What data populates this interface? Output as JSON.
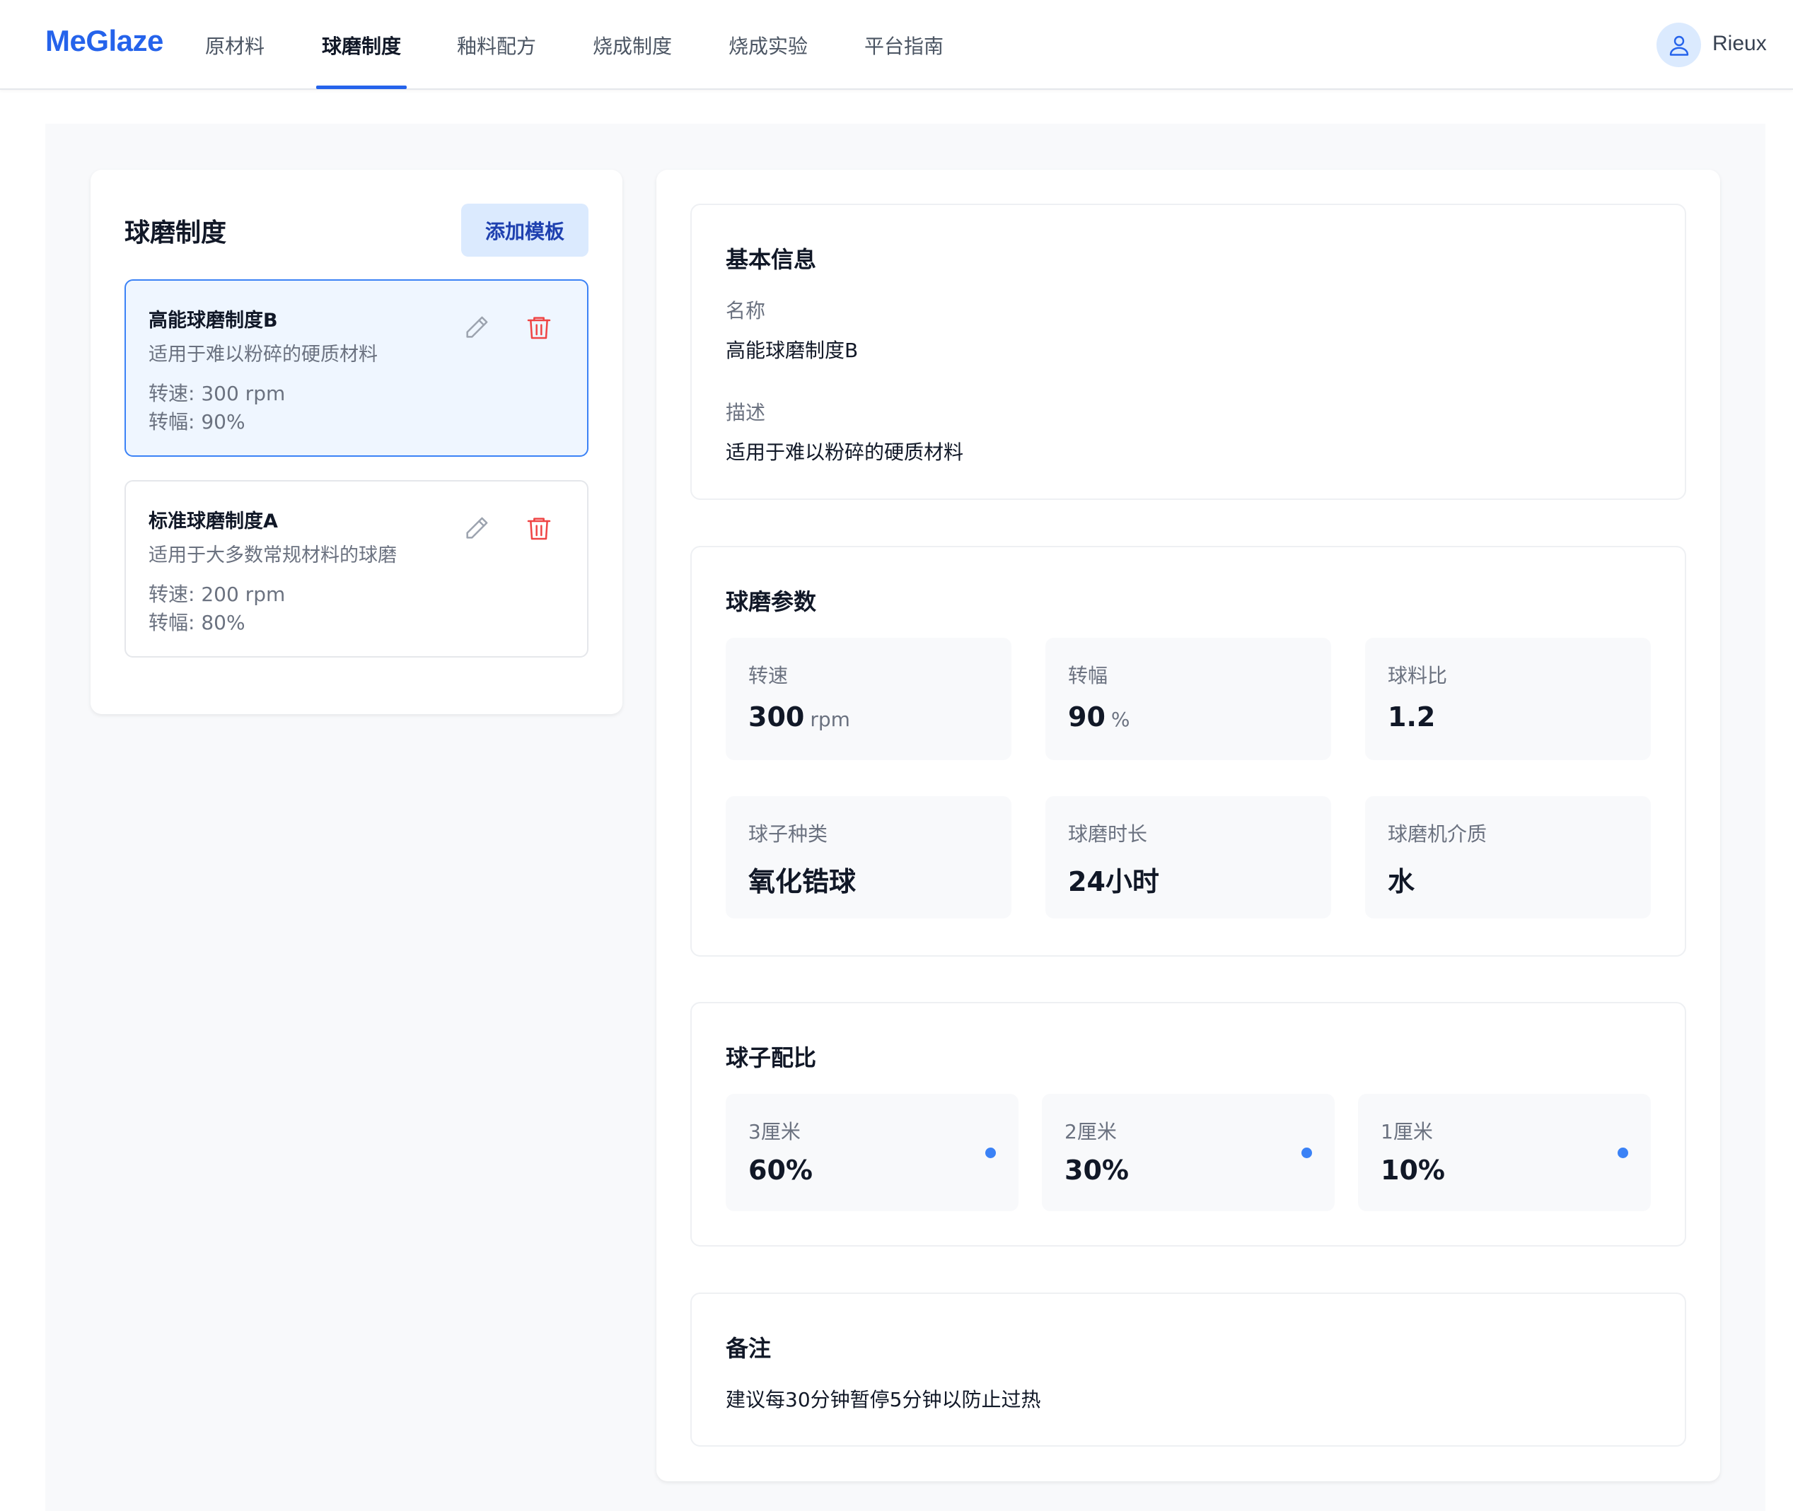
{
  "app": {
    "logo": "MeGlaze",
    "user": "Rieux"
  },
  "nav": {
    "items": [
      {
        "label": "原材料"
      },
      {
        "label": "球磨制度"
      },
      {
        "label": "釉料配方"
      },
      {
        "label": "烧成制度"
      },
      {
        "label": "烧成实验"
      },
      {
        "label": "平台指南"
      }
    ],
    "active": "球磨制度"
  },
  "sidebar": {
    "title": "球磨制度",
    "add_button": "添加模板",
    "templates": [
      {
        "name": "高能球磨制度B",
        "desc": "适用于难以粉碎的硬质材料",
        "speed": "转速: 300 rpm",
        "amplitude": "转幅: 90%",
        "selected": true
      },
      {
        "name": "标准球磨制度A",
        "desc": "适用于大多数常规材料的球磨",
        "speed": "转速: 200 rpm",
        "amplitude": "转幅: 80%",
        "selected": false
      }
    ]
  },
  "detail": {
    "basic": {
      "title": "基本信息",
      "name_label": "名称",
      "name_value": "高能球磨制度B",
      "desc_label": "描述",
      "desc_value": "适用于难以粉碎的硬质材料"
    },
    "params": {
      "title": "球磨参数",
      "items": [
        {
          "label": "转速",
          "value": "300",
          "unit": "rpm"
        },
        {
          "label": "转幅",
          "value": "90",
          "unit": "%"
        },
        {
          "label": "球料比",
          "value": "1.2",
          "unit": ""
        },
        {
          "label": "球子种类",
          "value": "氧化锆球",
          "unit": ""
        },
        {
          "label": "球磨时长",
          "value": "24小时",
          "unit": ""
        },
        {
          "label": "球磨机介质",
          "value": "水",
          "unit": ""
        }
      ]
    },
    "ball_ratio": {
      "title": "球子配比",
      "items": [
        {
          "label": "3厘米",
          "value": "60%"
        },
        {
          "label": "2厘米",
          "value": "30%"
        },
        {
          "label": "1厘米",
          "value": "10%"
        }
      ]
    },
    "notes": {
      "title": "备注",
      "text": "建议每30分钟暂停5分钟以防止过热"
    }
  },
  "colors": {
    "accent": "#2563eb",
    "selected_bg": "#eff6ff",
    "selected_border": "#3b82f6",
    "delete": "#ef4444",
    "dot": "#3b82f6"
  },
  "icons": {
    "edit": "pencil-icon",
    "delete": "trash-icon",
    "user": "user-icon"
  }
}
